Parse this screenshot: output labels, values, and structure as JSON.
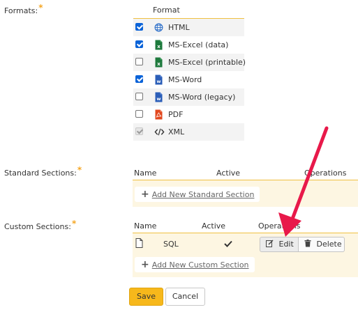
{
  "formats": {
    "label": "Formats:",
    "required_marker": "*",
    "column_header": "Format",
    "items": [
      {
        "name": "HTML",
        "checked": true,
        "disabled": false,
        "icon": "globe-icon"
      },
      {
        "name": "MS-Excel (data)",
        "checked": true,
        "disabled": false,
        "icon": "excel-icon"
      },
      {
        "name": "MS-Excel (printable)",
        "checked": false,
        "disabled": false,
        "icon": "excel-icon"
      },
      {
        "name": "MS-Word",
        "checked": true,
        "disabled": false,
        "icon": "word-icon"
      },
      {
        "name": "MS-Word (legacy)",
        "checked": false,
        "disabled": false,
        "icon": "word-icon"
      },
      {
        "name": "PDF",
        "checked": false,
        "disabled": false,
        "icon": "pdf-icon"
      },
      {
        "name": "XML",
        "checked": true,
        "disabled": true,
        "icon": "code-icon"
      }
    ]
  },
  "standard_sections": {
    "label": "Standard Sections:",
    "required_marker": "*",
    "headers": {
      "name": "Name",
      "active": "Active",
      "operations": "Operations"
    },
    "add_link": "Add New Standard Section"
  },
  "custom_sections": {
    "label": "Custom Sections:",
    "required_marker": "*",
    "headers": {
      "name": "Name",
      "active": "Active",
      "operations": "Operations"
    },
    "rows": [
      {
        "name": "SQL",
        "active": true,
        "edit_label": "Edit",
        "delete_label": "Delete"
      }
    ],
    "add_link": "Add New Custom Section"
  },
  "actions": {
    "save": "Save",
    "cancel": "Cancel"
  },
  "colors": {
    "accent": "#f7b81b",
    "arrow": "#e8194a",
    "checkbox": "#0b63d8"
  }
}
